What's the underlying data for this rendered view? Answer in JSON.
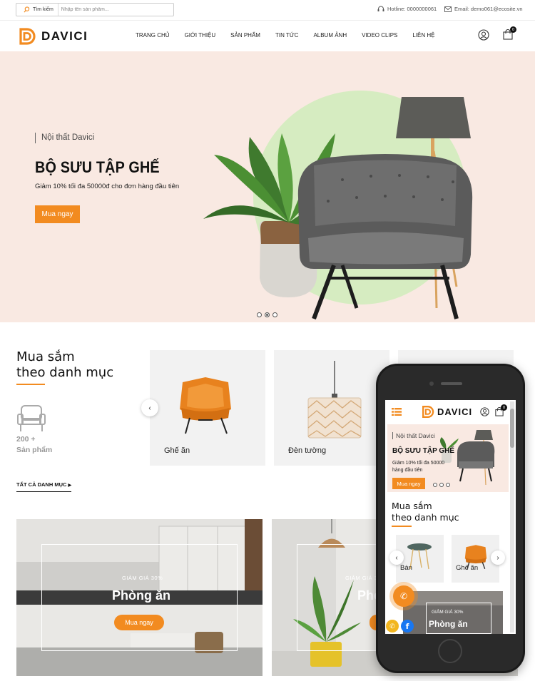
{
  "topbar": {
    "search_button": "Tìm kiếm",
    "search_placeholder": "Nhập tên sản phẩm...",
    "hotline": "Hotline: 0000000061",
    "email": "Email: demo061@ecosite.vn"
  },
  "header": {
    "logo_text": "DAVICI",
    "nav": [
      "TRANG CHỦ",
      "GIỚI THIỆU",
      "SẢN PHẨM",
      "TIN TỨC",
      "ALBUM ẢNH",
      "VIDEO CLIPS",
      "LIÊN HỆ"
    ],
    "cart_count": "0"
  },
  "hero": {
    "subtitle": "Nội thất Davici",
    "title": "BỘ SƯU TẬP GHẾ",
    "description": "Giảm 10% tối đa 50000đ cho đơn hàng đầu tiên",
    "button": "Mua ngay",
    "slide_count": 3,
    "active_slide": 2
  },
  "categories": {
    "heading_line1": "Mua sắm",
    "heading_line2": "theo danh mục",
    "count_line1": "200 +",
    "count_line2": "Sản phẩm",
    "all_link": "TẤT CẢ DANH MỤC",
    "items": [
      {
        "label": "Ghế ăn",
        "icon": "armchair"
      },
      {
        "label": "Đèn tường",
        "icon": "pendant-lamp"
      }
    ]
  },
  "banners": [
    {
      "sale": "GIẢM GIÁ 30%",
      "title": "Phòng ăn",
      "button": "Mua ngay"
    },
    {
      "sale": "GIẢM GIÁ 30%",
      "title": "Phò"
    }
  ],
  "mobile": {
    "logo_text": "DAVICI",
    "cart_count": "0",
    "hero_subtitle": "Nội thất Davici",
    "hero_title": "BỘ SƯU TẬP GHẾ",
    "hero_desc_line1": "Giảm 10% tối đa 50000",
    "hero_desc_line2": "hàng đầu tiên",
    "hero_button": "Mua ngay",
    "cat_line1": "Mua sắm",
    "cat_line2": "theo danh mục",
    "cards": [
      "Bàn",
      "Ghế ăn"
    ],
    "banner_sale": "GIẢM GIÁ 30%",
    "banner_title": "Phòng ăn"
  },
  "colors": {
    "accent": "#f28b20",
    "hero_bg": "#f9e9e2",
    "hero_circle": "#d6ecc1"
  }
}
